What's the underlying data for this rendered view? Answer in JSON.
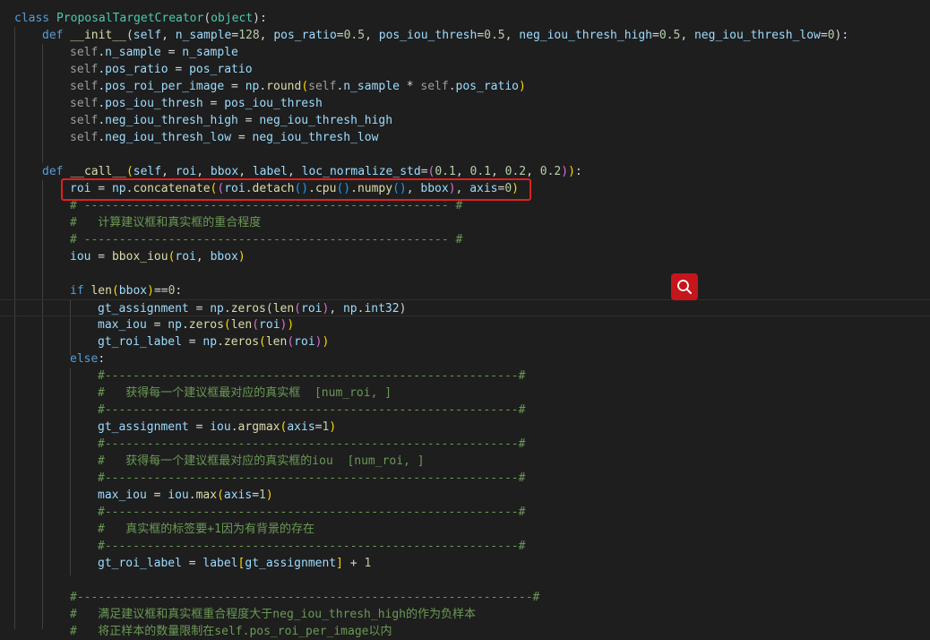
{
  "editor": {
    "lines": [
      [
        [
          "kw",
          "class "
        ],
        [
          "cls",
          "ProposalTargetCreator"
        ],
        [
          "tx",
          "("
        ],
        [
          "cls",
          "object"
        ],
        [
          "tx",
          "):"
        ]
      ],
      [
        [
          "kw",
          "def "
        ],
        [
          "fn",
          "__init__"
        ],
        [
          "tx",
          "("
        ],
        [
          "pm",
          "self"
        ],
        [
          "tx",
          ", "
        ],
        [
          "pm",
          "n_sample"
        ],
        [
          "tx",
          "="
        ],
        [
          "num",
          "128"
        ],
        [
          "tx",
          ", "
        ],
        [
          "pm",
          "pos_ratio"
        ],
        [
          "tx",
          "="
        ],
        [
          "num",
          "0.5"
        ],
        [
          "tx",
          ", "
        ],
        [
          "pm",
          "pos_iou_thresh"
        ],
        [
          "tx",
          "="
        ],
        [
          "num",
          "0.5"
        ],
        [
          "tx",
          ", "
        ],
        [
          "pm",
          "neg_iou_thresh_high"
        ],
        [
          "tx",
          "="
        ],
        [
          "num",
          "0.5"
        ],
        [
          "tx",
          ", "
        ],
        [
          "pm",
          "neg_iou_thresh_low"
        ],
        [
          "tx",
          "="
        ],
        [
          "num",
          "0"
        ],
        [
          "tx",
          "):"
        ]
      ],
      [
        [
          "sf",
          "self"
        ],
        [
          "tx",
          "."
        ],
        [
          "pm",
          "n_sample"
        ],
        [
          "tx",
          " = "
        ],
        [
          "pm",
          "n_sample"
        ]
      ],
      [
        [
          "sf",
          "self"
        ],
        [
          "tx",
          "."
        ],
        [
          "pm",
          "pos_ratio"
        ],
        [
          "tx",
          " = "
        ],
        [
          "pm",
          "pos_ratio"
        ]
      ],
      [
        [
          "sf",
          "self"
        ],
        [
          "tx",
          "."
        ],
        [
          "pm",
          "pos_roi_per_image"
        ],
        [
          "tx",
          " = "
        ],
        [
          "pm",
          "np"
        ],
        [
          "tx",
          "."
        ],
        [
          "fn",
          "round"
        ],
        [
          "b1",
          "("
        ],
        [
          "sf",
          "self"
        ],
        [
          "tx",
          "."
        ],
        [
          "pm",
          "n_sample"
        ],
        [
          "tx",
          " * "
        ],
        [
          "sf",
          "self"
        ],
        [
          "tx",
          "."
        ],
        [
          "pm",
          "pos_ratio"
        ],
        [
          "b1",
          ")"
        ]
      ],
      [
        [
          "sf",
          "self"
        ],
        [
          "tx",
          "."
        ],
        [
          "pm",
          "pos_iou_thresh"
        ],
        [
          "tx",
          " = "
        ],
        [
          "pm",
          "pos_iou_thresh"
        ]
      ],
      [
        [
          "sf",
          "self"
        ],
        [
          "tx",
          "."
        ],
        [
          "pm",
          "neg_iou_thresh_high"
        ],
        [
          "tx",
          " = "
        ],
        [
          "pm",
          "neg_iou_thresh_high"
        ]
      ],
      [
        [
          "sf",
          "self"
        ],
        [
          "tx",
          "."
        ],
        [
          "pm",
          "neg_iou_thresh_low"
        ],
        [
          "tx",
          " = "
        ],
        [
          "pm",
          "neg_iou_thresh_low"
        ]
      ],
      [],
      [
        [
          "kw",
          "def "
        ],
        [
          "fn",
          "__call__"
        ],
        [
          "b1",
          "("
        ],
        [
          "pm",
          "self"
        ],
        [
          "tx",
          ", "
        ],
        [
          "pm",
          "roi"
        ],
        [
          "tx",
          ", "
        ],
        [
          "pm",
          "bbox"
        ],
        [
          "tx",
          ", "
        ],
        [
          "pm",
          "label"
        ],
        [
          "tx",
          ", "
        ],
        [
          "pm",
          "loc_normalize_std"
        ],
        [
          "tx",
          "="
        ],
        [
          "b2",
          "("
        ],
        [
          "num",
          "0.1"
        ],
        [
          "tx",
          ", "
        ],
        [
          "num",
          "0.1"
        ],
        [
          "tx",
          ", "
        ],
        [
          "num",
          "0.2"
        ],
        [
          "tx",
          ", "
        ],
        [
          "num",
          "0.2"
        ],
        [
          "b2",
          ")"
        ],
        [
          "b1",
          ")"
        ],
        [
          "tx",
          ":"
        ]
      ],
      [
        [
          "pm",
          "roi"
        ],
        [
          "tx",
          " = "
        ],
        [
          "pm",
          "np"
        ],
        [
          "tx",
          "."
        ],
        [
          "fn",
          "concatenate"
        ],
        [
          "b1",
          "("
        ],
        [
          "b2",
          "("
        ],
        [
          "pm",
          "roi"
        ],
        [
          "tx",
          "."
        ],
        [
          "fn",
          "detach"
        ],
        [
          "b3",
          "()"
        ],
        [
          "tx",
          "."
        ],
        [
          "fn",
          "cpu"
        ],
        [
          "b3",
          "()"
        ],
        [
          "tx",
          "."
        ],
        [
          "fn",
          "numpy"
        ],
        [
          "b3",
          "()"
        ],
        [
          "tx",
          ", "
        ],
        [
          "pm",
          "bbox"
        ],
        [
          "b2",
          ")"
        ],
        [
          "tx",
          ", "
        ],
        [
          "pm",
          "axis"
        ],
        [
          "tx",
          "="
        ],
        [
          "num",
          "0"
        ],
        [
          "b1",
          ")"
        ]
      ],
      [
        [
          "cm",
          "# ---------------------------------------------------- #"
        ]
      ],
      [
        [
          "cm",
          "#   计算建议框和真实框的重合程度"
        ]
      ],
      [
        [
          "cm",
          "# ---------------------------------------------------- #"
        ]
      ],
      [
        [
          "pm",
          "iou"
        ],
        [
          "tx",
          " = "
        ],
        [
          "fn",
          "bbox_iou"
        ],
        [
          "b1",
          "("
        ],
        [
          "pm",
          "roi"
        ],
        [
          "tx",
          ", "
        ],
        [
          "pm",
          "bbox"
        ],
        [
          "b1",
          ")"
        ]
      ],
      [],
      [
        [
          "kw",
          "if "
        ],
        [
          "fn",
          "len"
        ],
        [
          "b1",
          "("
        ],
        [
          "pm",
          "bbox"
        ],
        [
          "b1",
          ")"
        ],
        [
          "tx",
          "=="
        ],
        [
          "num",
          "0"
        ],
        [
          "tx",
          ":"
        ]
      ],
      [
        [
          "pm",
          "gt_assignment"
        ],
        [
          "tx",
          " = "
        ],
        [
          "pm",
          "np"
        ],
        [
          "tx",
          "."
        ],
        [
          "fn",
          "zeros"
        ],
        [
          "bw",
          "("
        ],
        [
          "fn",
          "len"
        ],
        [
          "b2",
          "("
        ],
        [
          "pm",
          "roi"
        ],
        [
          "b2",
          ")"
        ],
        [
          "tx",
          ", "
        ],
        [
          "pm",
          "np"
        ],
        [
          "tx",
          "."
        ],
        [
          "pm",
          "int32"
        ],
        [
          "bw",
          ")"
        ]
      ],
      [
        [
          "pm",
          "max_iou"
        ],
        [
          "tx",
          " = "
        ],
        [
          "pm",
          "np"
        ],
        [
          "tx",
          "."
        ],
        [
          "fn",
          "zeros"
        ],
        [
          "b1",
          "("
        ],
        [
          "fn",
          "len"
        ],
        [
          "b2",
          "("
        ],
        [
          "pm",
          "roi"
        ],
        [
          "b2",
          ")"
        ],
        [
          "b1",
          ")"
        ]
      ],
      [
        [
          "pm",
          "gt_roi_label"
        ],
        [
          "tx",
          " = "
        ],
        [
          "pm",
          "np"
        ],
        [
          "tx",
          "."
        ],
        [
          "fn",
          "zeros"
        ],
        [
          "b1",
          "("
        ],
        [
          "fn",
          "len"
        ],
        [
          "b2",
          "("
        ],
        [
          "pm",
          "roi"
        ],
        [
          "b2",
          ")"
        ],
        [
          "b1",
          ")"
        ]
      ],
      [
        [
          "kw",
          "else"
        ],
        [
          "tx",
          ":"
        ]
      ],
      [
        [
          "cm",
          "#-----------------------------------------------------------#"
        ]
      ],
      [
        [
          "cm",
          "#   获得每一个建议框最对应的真实框  [num_roi, ]"
        ]
      ],
      [
        [
          "cm",
          "#-----------------------------------------------------------#"
        ]
      ],
      [
        [
          "pm",
          "gt_assignment"
        ],
        [
          "tx",
          " = "
        ],
        [
          "pm",
          "iou"
        ],
        [
          "tx",
          "."
        ],
        [
          "fn",
          "argmax"
        ],
        [
          "b1",
          "("
        ],
        [
          "pm",
          "axis"
        ],
        [
          "tx",
          "="
        ],
        [
          "num",
          "1"
        ],
        [
          "b1",
          ")"
        ]
      ],
      [
        [
          "cm",
          "#-----------------------------------------------------------#"
        ]
      ],
      [
        [
          "cm",
          "#   获得每一个建议框最对应的真实框的iou  [num_roi, ]"
        ]
      ],
      [
        [
          "cm",
          "#-----------------------------------------------------------#"
        ]
      ],
      [
        [
          "pm",
          "max_iou"
        ],
        [
          "tx",
          " = "
        ],
        [
          "pm",
          "iou"
        ],
        [
          "tx",
          "."
        ],
        [
          "fn",
          "max"
        ],
        [
          "b1",
          "("
        ],
        [
          "pm",
          "axis"
        ],
        [
          "tx",
          "="
        ],
        [
          "num",
          "1"
        ],
        [
          "b1",
          ")"
        ]
      ],
      [
        [
          "cm",
          "#-----------------------------------------------------------#"
        ]
      ],
      [
        [
          "cm",
          "#   真实框的标签要+1因为有背景的存在"
        ]
      ],
      [
        [
          "cm",
          "#-----------------------------------------------------------#"
        ]
      ],
      [
        [
          "pm",
          "gt_roi_label"
        ],
        [
          "tx",
          " = "
        ],
        [
          "pm",
          "label"
        ],
        [
          "b1",
          "["
        ],
        [
          "pm",
          "gt_assignment"
        ],
        [
          "b1",
          "]"
        ],
        [
          "tx",
          " + "
        ],
        [
          "num",
          "1"
        ]
      ],
      [],
      [
        [
          "cm",
          "#-----------------------------------------------------------------#"
        ]
      ],
      [
        [
          "cm",
          "#   满足建议框和真实框重合程度大于neg_iou_thresh_high的作为负样本"
        ]
      ],
      [
        [
          "cm",
          "#   将正样本的数量限制在self.pos_roi_per_image以内"
        ]
      ]
    ]
  },
  "search_button": {
    "icon": "search-icon",
    "color": "#c4161c"
  },
  "highlight": {
    "color": "#e02020"
  }
}
